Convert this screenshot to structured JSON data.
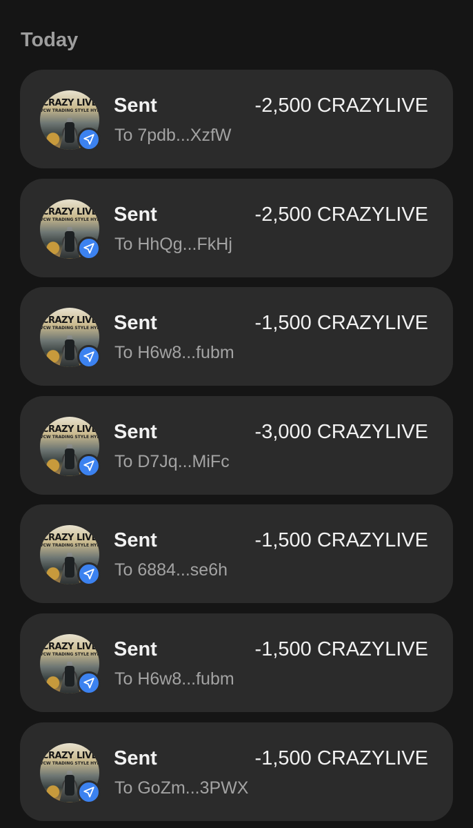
{
  "section": {
    "title": "Today"
  },
  "colors": {
    "background": "#151515",
    "card": "#2b2b2b",
    "badge": "#3c82f0"
  },
  "transactions": [
    {
      "kind": "Sent",
      "amount": "-2,500 CRAZYLIVE",
      "to": "To 7pdb...XzfW",
      "token_icon": "crazylive-token-icon",
      "status_icon": "send-arrow-icon",
      "token_label": "CRAZY LIVE",
      "token_sublabel": "VCW TRADING STYLE HYLJ"
    },
    {
      "kind": "Sent",
      "amount": "-2,500 CRAZYLIVE",
      "to": "To HhQg...FkHj",
      "token_icon": "crazylive-token-icon",
      "status_icon": "send-arrow-icon",
      "token_label": "CRAZY LIVE",
      "token_sublabel": "VCW TRADING STYLE HYLJ"
    },
    {
      "kind": "Sent",
      "amount": "-1,500 CRAZYLIVE",
      "to": "To H6w8...fubm",
      "token_icon": "crazylive-token-icon",
      "status_icon": "send-arrow-icon",
      "token_label": "CRAZY LIVE",
      "token_sublabel": "VCW TRADING STYLE HYLJ"
    },
    {
      "kind": "Sent",
      "amount": "-3,000 CRAZYLIVE",
      "to": "To D7Jq...MiFc",
      "token_icon": "crazylive-token-icon",
      "status_icon": "send-arrow-icon",
      "token_label": "CRAZY LIVE",
      "token_sublabel": "VCW TRADING STYLE HYLJ"
    },
    {
      "kind": "Sent",
      "amount": "-1,500 CRAZYLIVE",
      "to": "To 6884...se6h",
      "token_icon": "crazylive-token-icon",
      "status_icon": "send-arrow-icon",
      "token_label": "CRAZY LIVE",
      "token_sublabel": "VCW TRADING STYLE HYLJ"
    },
    {
      "kind": "Sent",
      "amount": "-1,500 CRAZYLIVE",
      "to": "To H6w8...fubm",
      "token_icon": "crazylive-token-icon",
      "status_icon": "send-arrow-icon",
      "token_label": "CRAZY LIVE",
      "token_sublabel": "VCW TRADING STYLE HYLJ"
    },
    {
      "kind": "Sent",
      "amount": "-1,500 CRAZYLIVE",
      "to": "To GoZm...3PWX",
      "token_icon": "crazylive-token-icon",
      "status_icon": "send-arrow-icon",
      "token_label": "CRAZY LIVE",
      "token_sublabel": "VCW TRADING STYLE HYLJ"
    }
  ]
}
